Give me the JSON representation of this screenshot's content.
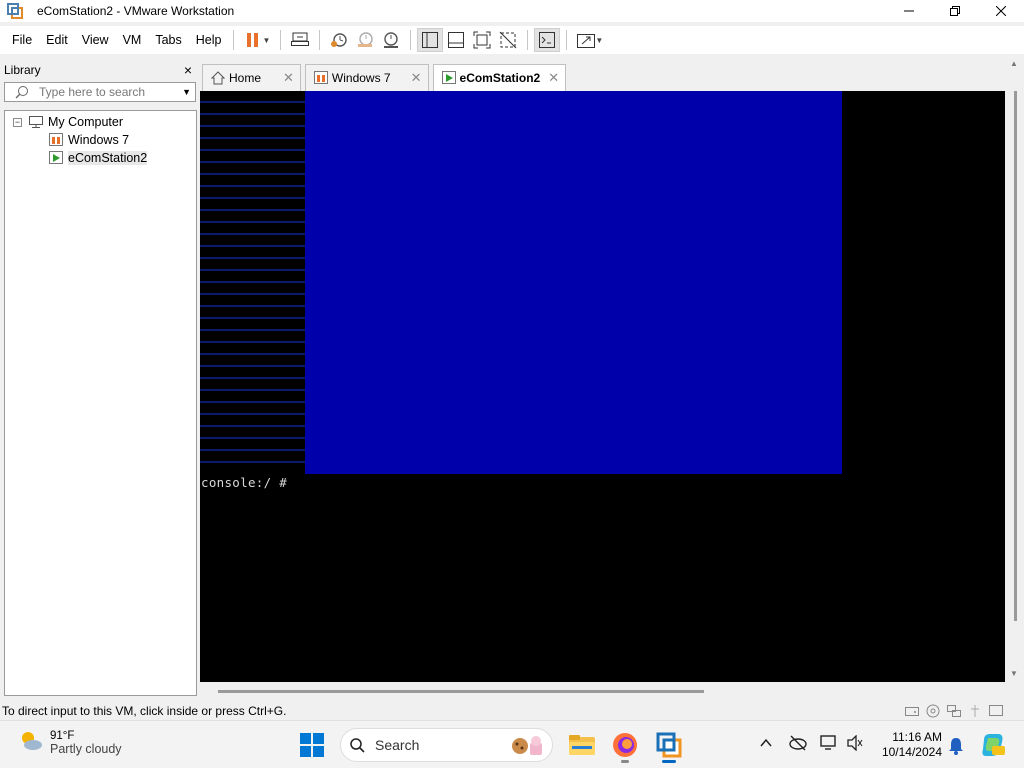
{
  "window": {
    "title": "eComStation2 - VMware Workstation",
    "controls": {
      "minimize": "─",
      "restore": "❐",
      "close": "✕"
    }
  },
  "menu": {
    "items": [
      "File",
      "Edit",
      "View",
      "VM",
      "Tabs",
      "Help"
    ],
    "toolbar_icons": [
      "pause-icon",
      "send-ctrl-alt-del-icon",
      "snapshot-icon",
      "revert-snapshot-icon",
      "snapshot-manager-icon",
      "show-library-icon",
      "thumbnail-bar-icon",
      "full-screen-icon",
      "unity-icon",
      "console-view-icon",
      "stretch-guest-icon"
    ]
  },
  "library": {
    "title": "Library",
    "close": "×",
    "search_placeholder": "Type here to search",
    "tree": {
      "root": "My Computer",
      "toggle": "−",
      "children": [
        "Windows 7",
        "eComStation2"
      ],
      "selected": "eComStation2"
    }
  },
  "tabs": [
    {
      "label": "Home",
      "icon": "home-icon",
      "active": false
    },
    {
      "label": "Windows 7",
      "icon": "vm-icon",
      "active": false
    },
    {
      "label": "eComStation2",
      "icon": "vm-running-icon",
      "active": true
    }
  ],
  "tab_close_glyph": "✕",
  "vm_screen": {
    "console_text": "console:/ #",
    "blue_color": "#0000aa"
  },
  "status": {
    "text": "To direct input to this VM, click inside or press Ctrl+G."
  },
  "taskbar": {
    "weather": {
      "temp": "91°F",
      "condition": "Partly cloudy"
    },
    "search_label": "Search",
    "clock": {
      "time": "11:16 AM",
      "date": "10/14/2024"
    },
    "tray_chevron": "^"
  },
  "colors": {
    "accent": "#0067c0",
    "pause_orange": "#e8702a",
    "vm_blue": "#0000aa"
  }
}
